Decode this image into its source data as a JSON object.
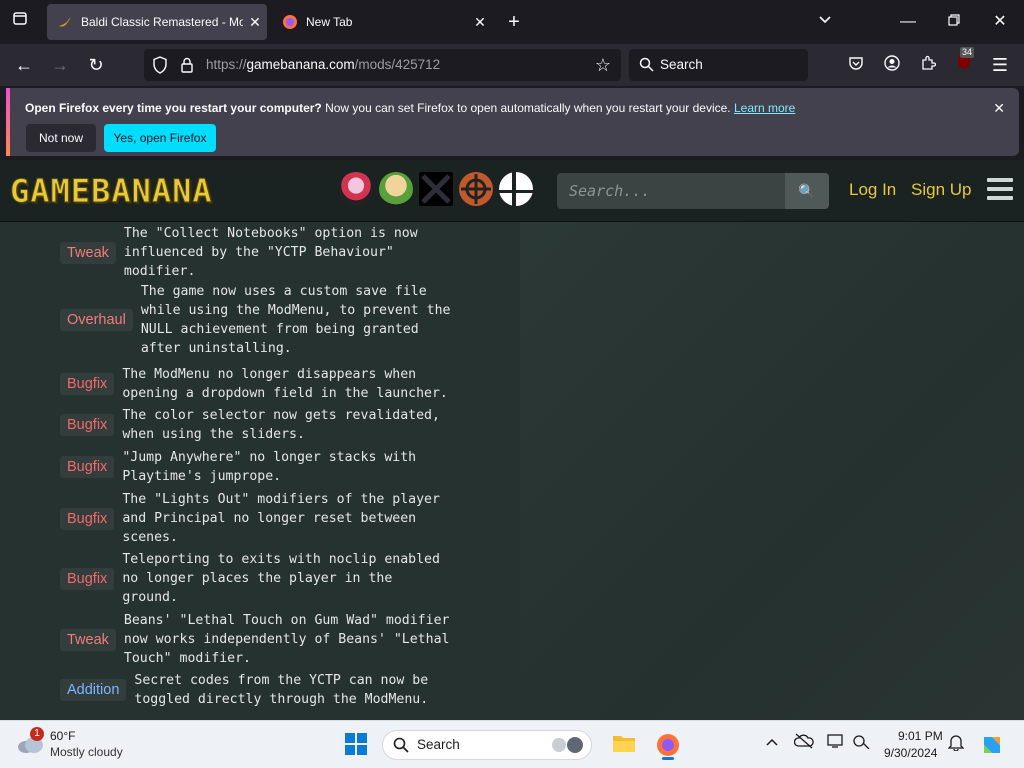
{
  "browser": {
    "tabs": [
      {
        "title": "Baldi Classic Remastered - Moc",
        "active": true,
        "favicon": "banana-icon"
      },
      {
        "title": "New Tab",
        "active": false,
        "favicon": "firefox-icon"
      }
    ],
    "url_scheme": "https://",
    "url_host": "gamebanana.com",
    "url_path": "/mods/425712",
    "search_placeholder": "Search",
    "extension_badge": "34"
  },
  "notification": {
    "bold": "Open Firefox every time you restart your computer?",
    "text": " Now you can set Firefox to open automatically when you restart your device.",
    "link": "Learn more",
    "btn_not_now": "Not now",
    "btn_yes": "Yes, open Firefox"
  },
  "site": {
    "logo": "GAMEBANANA",
    "search_placeholder": "Search...",
    "login": "Log In",
    "signup": "Sign Up",
    "colors": {
      "accent": "#e8c93a",
      "bugfix": "#f26a6a",
      "addition": "#7ab8ff"
    }
  },
  "changelog": [
    {
      "tag": "Tweak",
      "kind": "tweak",
      "lines": [
        "The \"Collect Notebooks\" option is now",
        "influenced by the \"YCTP Behaviour\"",
        "modifier."
      ]
    },
    {
      "tag": "Overhaul",
      "kind": "overhaul",
      "lines": [
        "The game now uses a custom save file",
        "while using the ModMenu, to prevent the",
        "NULL achievement from being granted",
        "after uninstalling."
      ]
    },
    {
      "tag": "Bugfix",
      "kind": "bugfix",
      "lines": [
        "The ModMenu no longer disappears when",
        "opening a dropdown field in the launcher."
      ]
    },
    {
      "tag": "Bugfix",
      "kind": "bugfix",
      "lines": [
        "The color selector now gets revalidated,",
        "when using the sliders."
      ]
    },
    {
      "tag": "Bugfix",
      "kind": "bugfix",
      "lines": [
        "\"Jump Anywhere\" no longer stacks with",
        "Playtime's jumprope."
      ]
    },
    {
      "tag": "Bugfix",
      "kind": "bugfix",
      "lines": [
        "The \"Lights Out\" modifiers of the player",
        "and Principal no longer reset between",
        "scenes."
      ]
    },
    {
      "tag": "Bugfix",
      "kind": "bugfix",
      "lines": [
        "Teleporting to exits with noclip enabled",
        "no longer places the player in the",
        "ground."
      ]
    },
    {
      "tag": "Tweak",
      "kind": "tweak",
      "lines": [
        "Beans' \"Lethal Touch on Gum Wad\" modifier",
        "now works independently of Beans' \"Lethal",
        "Touch\" modifier."
      ]
    },
    {
      "tag": "Addition",
      "kind": "addition",
      "lines": [
        "Secret codes from the YCTP can now be",
        "toggled directly through the ModMenu."
      ]
    }
  ],
  "taskbar": {
    "weather_temp": "60°F",
    "weather_desc": "Mostly cloudy",
    "weather_badge": "1",
    "search": "Search",
    "time": "9:01 PM",
    "date": "9/30/2024"
  }
}
